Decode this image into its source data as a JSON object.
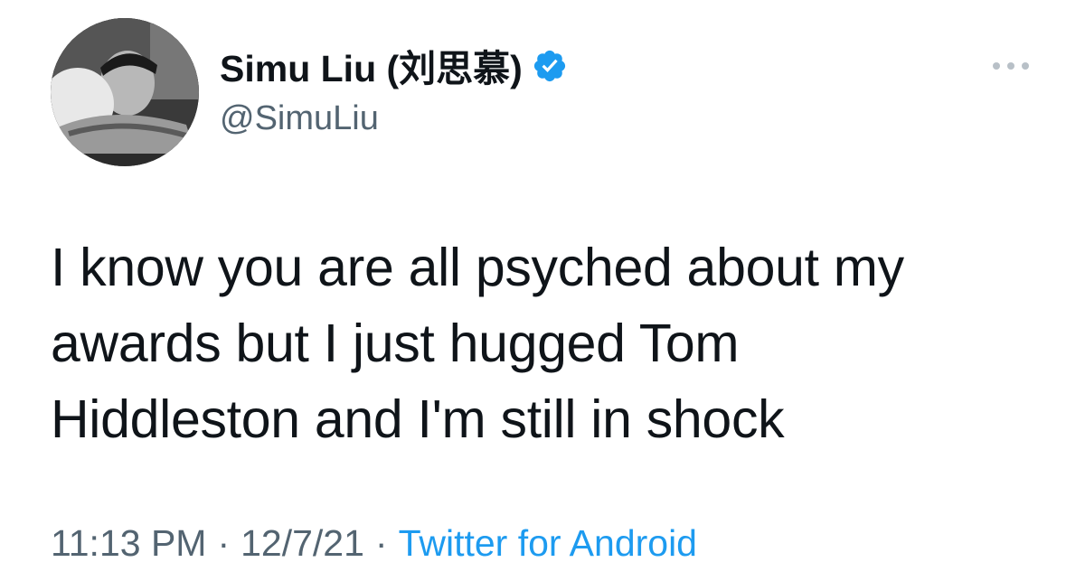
{
  "author": {
    "display_name": "Simu Liu (刘思慕)",
    "handle": "@SimuLiu",
    "verified": true
  },
  "tweet": {
    "text_lines": [
      "I know you are all psyched about my",
      "awards but I just hugged Tom",
      "Hiddleston and I'm still in shock"
    ],
    "time": "11:13 PM",
    "separator": "·",
    "date": "12/7/21",
    "source": "Twitter for Android"
  },
  "icons": {
    "verified": "verified-badge-icon",
    "more": "more-options-icon"
  },
  "colors": {
    "text": "#0f1419",
    "secondary": "#536471",
    "link": "#1d9bf0",
    "verified": "#1d9bf0"
  }
}
